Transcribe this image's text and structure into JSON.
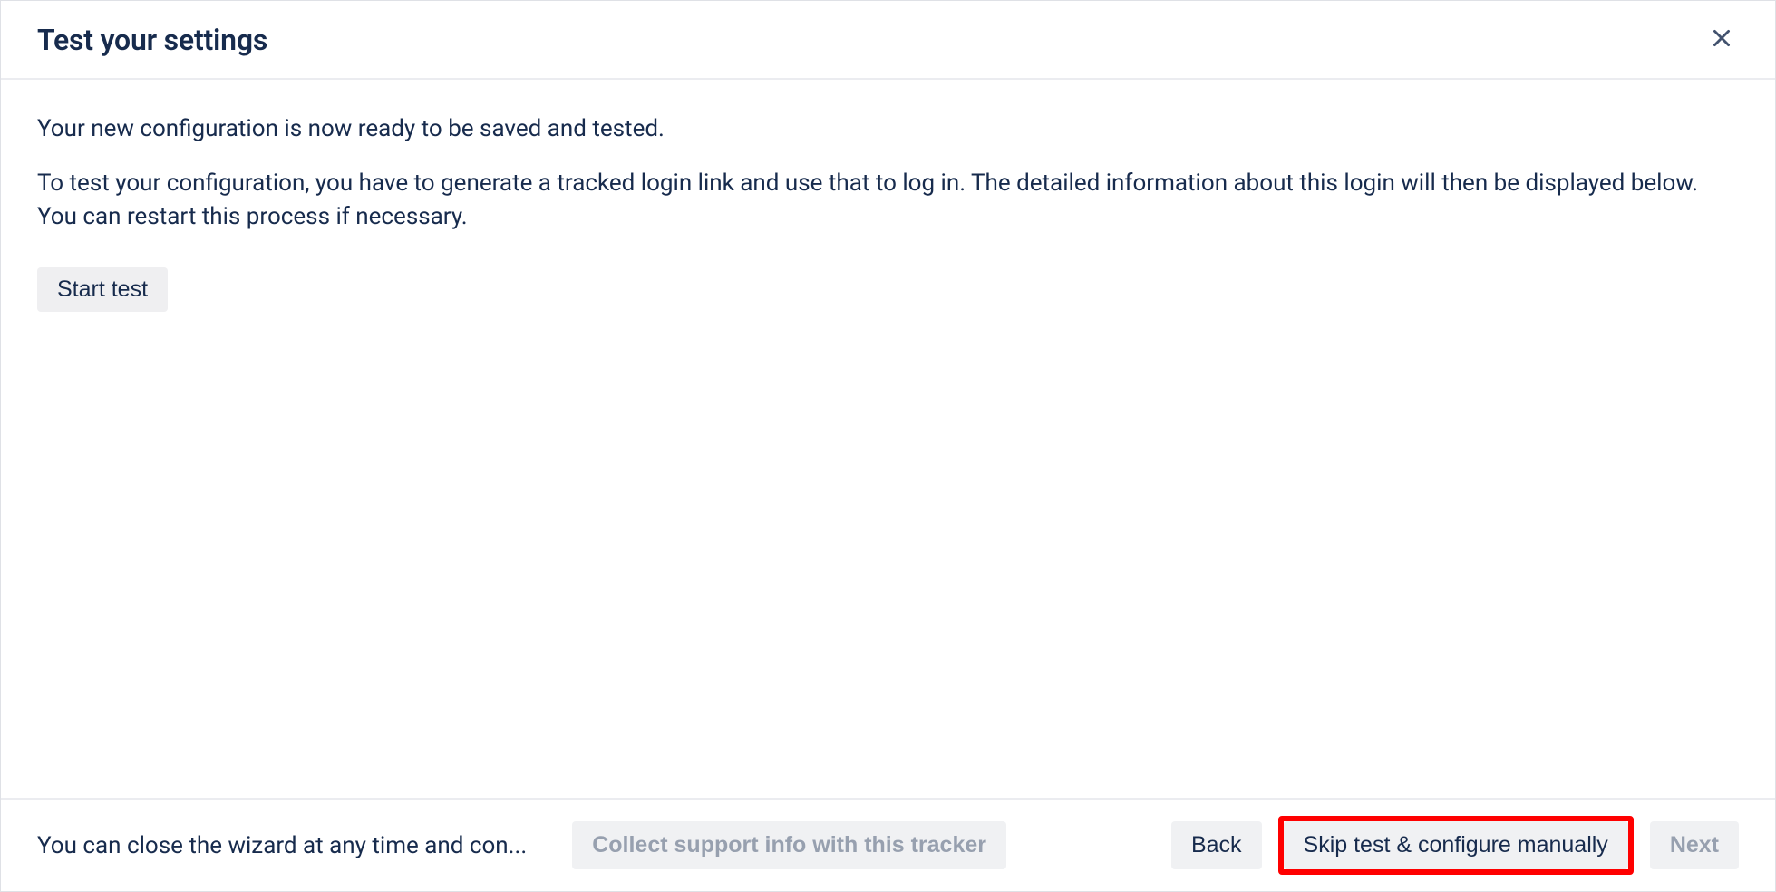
{
  "header": {
    "title": "Test your settings"
  },
  "body": {
    "p1": "Your new configuration is now ready to be saved and tested.",
    "p2": "To test your configuration, you have to generate a tracked login link and use that to log in. The detailed information about this login will then be displayed below. You can restart this process if necessary.",
    "start_test_label": "Start test"
  },
  "footer": {
    "note": "You can close the wizard at any time and con...",
    "collect_label": "Collect support info with this tracker",
    "back_label": "Back",
    "skip_label": "Skip test & configure manually",
    "next_label": "Next"
  }
}
